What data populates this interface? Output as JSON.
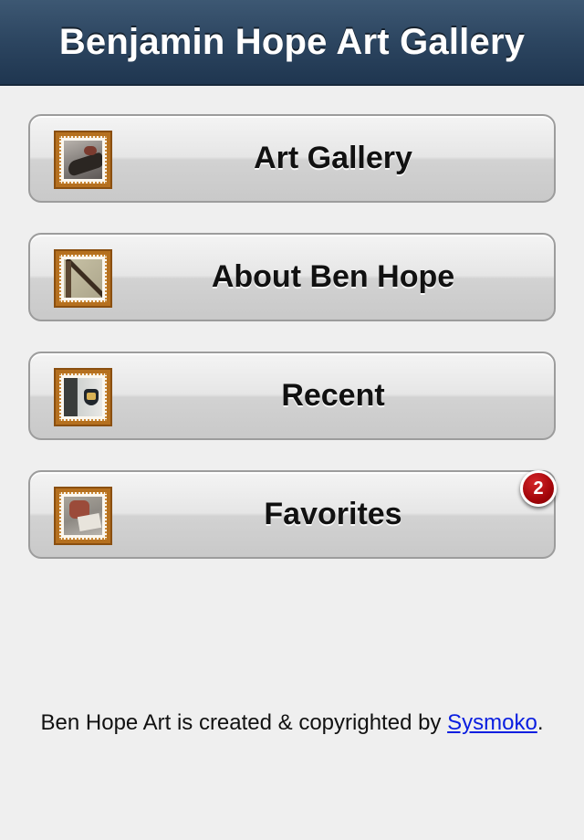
{
  "navbar": {
    "title": "Benjamin Hope Art Gallery"
  },
  "menu": {
    "items": [
      {
        "label": "Art Gallery",
        "icon": "art-gallery-thumbnail-icon"
      },
      {
        "label": "About Ben Hope",
        "icon": "about-thumbnail-icon"
      },
      {
        "label": "Recent",
        "icon": "recent-thumbnail-icon"
      },
      {
        "label": "Favorites",
        "icon": "favorites-thumbnail-icon",
        "badge": "2"
      }
    ]
  },
  "footer": {
    "text_before": "Ben Hope Art is created & copyrighted by ",
    "link_text": "Sysmoko",
    "text_after": "."
  },
  "colors": {
    "navbar": "#2c4560",
    "background": "#efefef",
    "badge": "#a4060a",
    "link": "#0a1ee0",
    "stamp_border": "#b5701f"
  }
}
